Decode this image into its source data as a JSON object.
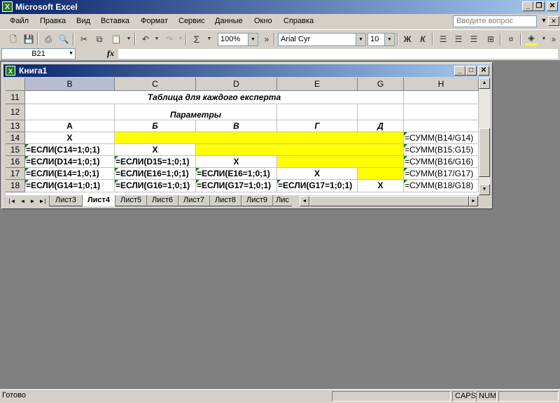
{
  "app": {
    "title": "Microsoft Excel",
    "icon_label": "X"
  },
  "menu": {
    "items": [
      "Файл",
      "Правка",
      "Вид",
      "Вставка",
      "Формат",
      "Сервис",
      "Данные",
      "Окно",
      "Справка"
    ],
    "ask_placeholder": "Введите вопрос"
  },
  "toolbar": {
    "zoom": "100%",
    "font": "Arial Cyr",
    "font_size": "10",
    "sigma": "Σ",
    "bold": "Ж",
    "italic": "К",
    "overflow": "»"
  },
  "formula_bar": {
    "name_box": "B21",
    "fx_label": "fx",
    "formula": ""
  },
  "workbook": {
    "title": "Книга1",
    "icon_label": "X"
  },
  "grid": {
    "columns": [
      "B",
      "C",
      "D",
      "E",
      "G",
      "H"
    ],
    "selected_column": "B",
    "rows": [
      "11",
      "12",
      "13",
      "14",
      "15",
      "16",
      "17",
      "18"
    ],
    "title_row": "Таблица для каждого експерта",
    "params_row": "Параметры",
    "header_row": [
      "А",
      "Б",
      "В",
      "Г",
      "Д"
    ],
    "r14": {
      "b": "X",
      "h": "=СУММ(B14/G14)"
    },
    "r15": {
      "b": "=ЕСЛИ(C14=1;0;1)",
      "c": "X",
      "h": "=СУММ(B15:G15)"
    },
    "r16": {
      "b": "=ЕСЛИ(D14=1;0;1)",
      "c": "=ЕСЛИ(D15=1;0;1)",
      "d": "X",
      "h": "=СУММ(B16/G16)"
    },
    "r17": {
      "b": "=ЕСЛИ(E14=1;0;1)",
      "c": "=ЕСЛИ(E16=1;0;1)",
      "d": "=ЕСЛИ(E16=1;0;1)",
      "e": "X",
      "h": "=СУММ(B17/G17)"
    },
    "r18": {
      "b": "=ЕСЛИ(G14=1;0;1)",
      "c": "=ЕСЛИ(G16=1;0;1)",
      "d": "=ЕСЛИ(G17=1;0;1)",
      "e": "=ЕСЛИ(G17=1;0;1)",
      "g": "X",
      "h": "=СУММ(B18/G18)"
    }
  },
  "sheets": {
    "tabs": [
      "Лист3",
      "Лист4",
      "Лист5",
      "Лист6",
      "Лист7",
      "Лист8",
      "Лист9",
      "Лис"
    ],
    "active": "Лист4"
  },
  "status": {
    "ready": "Готово",
    "caps": "CAPS",
    "num": "NUM"
  },
  "colors": {
    "title_start": "#0a246a",
    "title_end": "#a6caf0",
    "highlight": "#ffff00",
    "chrome": "#d4d0c8",
    "app_background": "#808080"
  }
}
